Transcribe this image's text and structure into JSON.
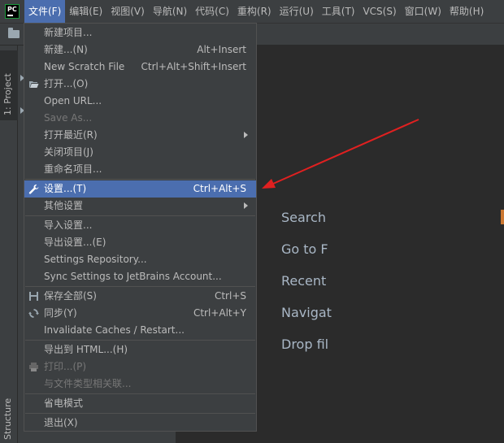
{
  "app": {
    "logo_text": "PC"
  },
  "menubar": [
    {
      "label": "文件(F)",
      "active": true
    },
    {
      "label": "编辑(E)"
    },
    {
      "label": "视图(V)"
    },
    {
      "label": "导航(N)"
    },
    {
      "label": "代码(C)"
    },
    {
      "label": "重构(R)"
    },
    {
      "label": "运行(U)"
    },
    {
      "label": "工具(T)"
    },
    {
      "label": "VCS(S)"
    },
    {
      "label": "窗口(W)"
    },
    {
      "label": "帮助(H)"
    }
  ],
  "side_tabs": {
    "project": "1: Project",
    "structure": "Structure"
  },
  "file_menu": {
    "items": [
      {
        "label": "新建项目..."
      },
      {
        "label": "新建...(N)",
        "shortcut": "Alt+Insert"
      },
      {
        "label": "New Scratch File",
        "shortcut": "Ctrl+Alt+Shift+Insert"
      },
      {
        "label": "打开...(O)",
        "icon": "folder-open-icon"
      },
      {
        "label": "Open URL..."
      },
      {
        "label": "Save As...",
        "disabled": true
      },
      {
        "label": "打开最近(R)",
        "submenu": true
      },
      {
        "label": "关闭项目(J)"
      },
      {
        "label": "重命名项目..."
      },
      {
        "label": "设置...(T)",
        "shortcut": "Ctrl+Alt+S",
        "icon": "wrench-icon",
        "highlighted": true
      },
      {
        "label": "其他设置",
        "submenu": true
      },
      {
        "label": "导入设置..."
      },
      {
        "label": "导出设置...(E)"
      },
      {
        "label": "Settings Repository..."
      },
      {
        "label": "Sync Settings to JetBrains Account..."
      },
      {
        "label": "保存全部(S)",
        "shortcut": "Ctrl+S",
        "icon": "save-icon"
      },
      {
        "label": "同步(Y)",
        "shortcut": "Ctrl+Alt+Y",
        "icon": "sync-icon"
      },
      {
        "label": "Invalidate Caches / Restart..."
      },
      {
        "label": "导出到 HTML...(H)"
      },
      {
        "label": "打印...(P)",
        "disabled": true,
        "icon": "print-icon"
      },
      {
        "label": "与文件类型相关联...",
        "disabled": true
      },
      {
        "label": "省电模式"
      },
      {
        "label": "退出(X)"
      }
    ]
  },
  "editor_hints": [
    "Search",
    "Go to F",
    "Recent",
    "Navigat",
    "Drop fil"
  ],
  "colors": {
    "accent": "#4b6eaf",
    "annotation_arrow": "#e02020",
    "cursor_accent": "#cc7832"
  }
}
